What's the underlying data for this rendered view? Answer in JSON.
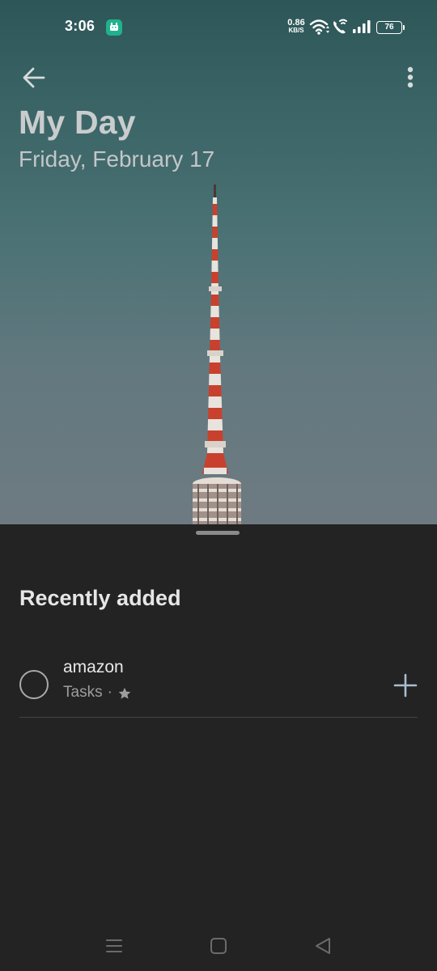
{
  "status_bar": {
    "time": "3:06",
    "net_speed_value": "0.86",
    "net_speed_unit": "KB/S",
    "battery": "76",
    "icons": [
      "app-notification-icon",
      "wifi-icon",
      "wifi-calling-icon",
      "signal-icon",
      "battery-icon"
    ]
  },
  "header": {
    "title": "My Day",
    "date": "Friday, February 17",
    "back_icon": "arrow-left-icon",
    "more_icon": "more-vertical-icon"
  },
  "sheet": {
    "section_title": "Recently added",
    "tasks": [
      {
        "title": "amazon",
        "list": "Tasks",
        "separator": "·",
        "important_icon": "star-icon",
        "action_icon": "plus-icon"
      }
    ]
  },
  "nav_bar": {
    "icons": [
      "recent-apps-icon",
      "home-icon",
      "back-triangle-icon"
    ]
  },
  "colors": {
    "sheet_bg": "#232323",
    "hero_top": "#2d5657",
    "hero_bottom": "#6f7a82",
    "title_text": "#c9cccd",
    "tower_red": "#c8412e",
    "tower_white": "#e8e3dd"
  }
}
